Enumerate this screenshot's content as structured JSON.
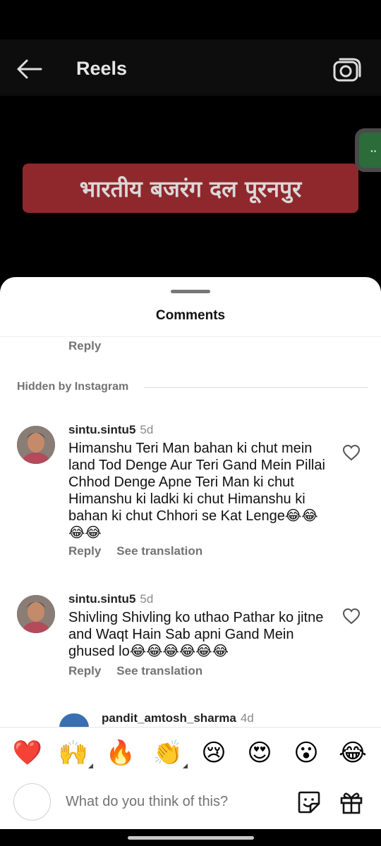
{
  "header": {
    "title": "Reels"
  },
  "reel": {
    "banner_text": "भारतीय बजरंग दल पूरनपुर",
    "side_bubble_label": "··"
  },
  "sheet": {
    "title": "Comments",
    "top_reply_label": "Reply",
    "hidden_label": "Hidden by Instagram"
  },
  "comments": [
    {
      "username": "sintu.sintu5",
      "time": "5d",
      "text": "Himanshu Teri Man bahan ki chut mein land Tod Denge Aur Teri Gand Mein Pillai Chhod Denge Apne Teri Man ki chut Himanshu ki ladki ki chut Himanshu ki bahan ki chut Chhori se Kat Lenge😂😂😂😂",
      "reply_label": "Reply",
      "translate_label": "See translation"
    },
    {
      "username": "sintu.sintu5",
      "time": "5d",
      "text": "Shivling Shivling ko uthao Pathar ko jitne and Waqt Hain Sab apni Gand Mein ghused lo😂😂😂😂😂😂",
      "reply_label": "Reply",
      "translate_label": "See translation"
    }
  ],
  "partial_comment": {
    "username": "pandit_amtosh_sharma",
    "time": "4d"
  },
  "emoji_bar": [
    "❤️",
    "🙌",
    "🔥",
    "👏",
    "😢",
    "😍",
    "😮",
    "😂"
  ],
  "composer": {
    "placeholder": "What do you think of this?"
  }
}
